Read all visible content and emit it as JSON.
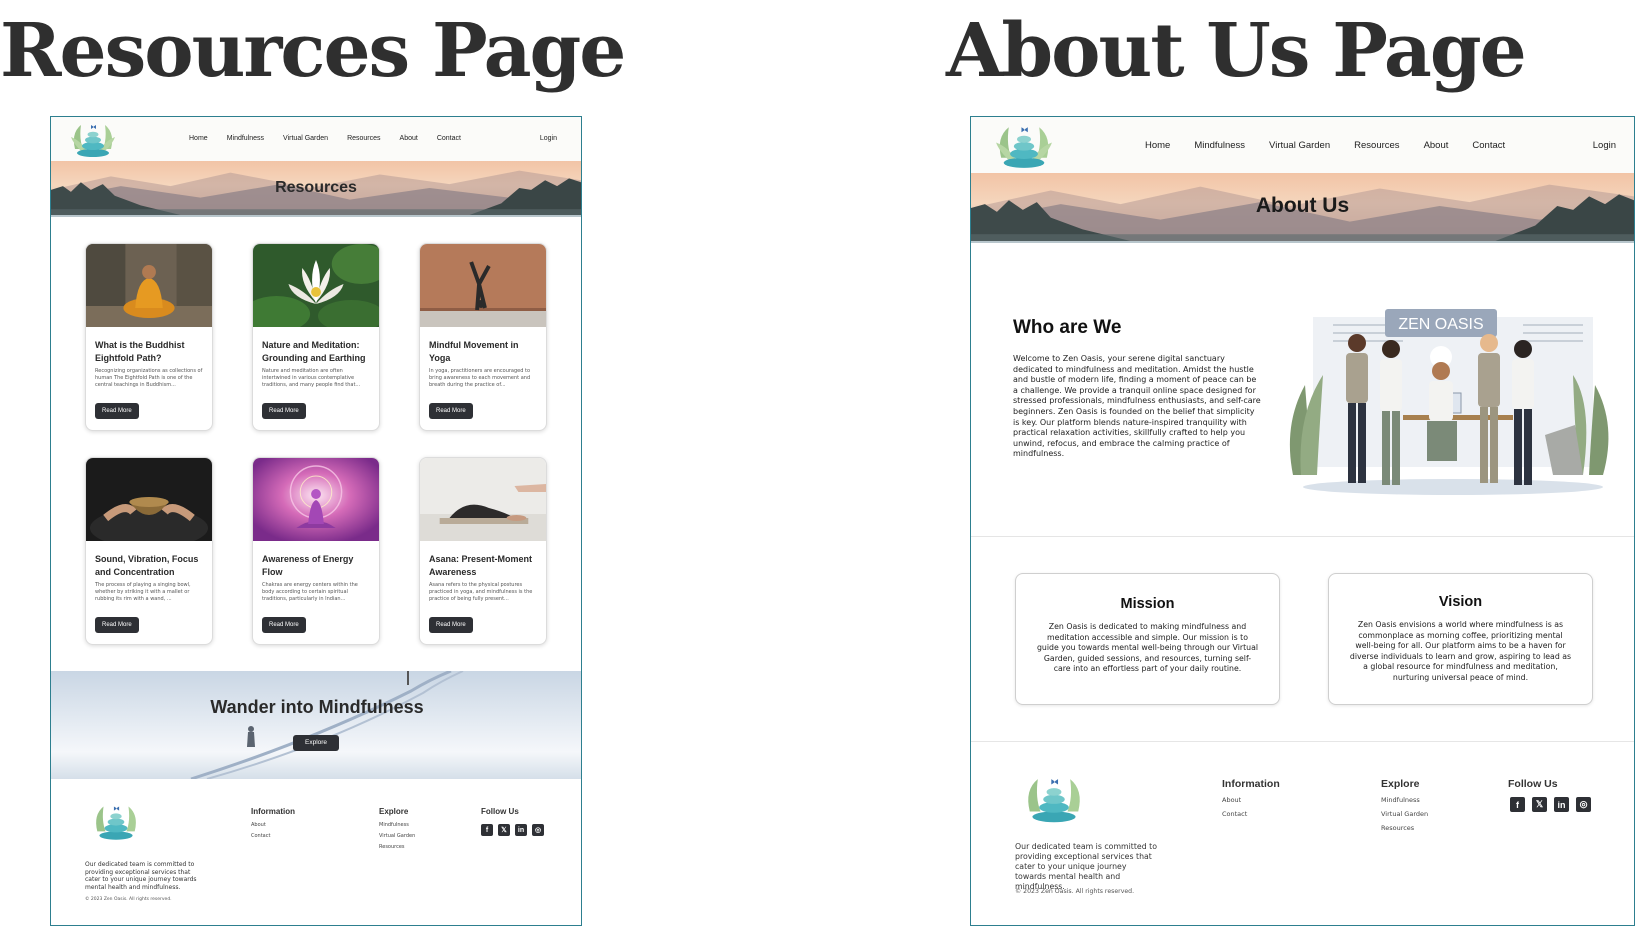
{
  "titles": {
    "left": "Resources Page",
    "right": "About Us Page"
  },
  "nav": {
    "items": [
      "Home",
      "Mindfulness",
      "Virtual Garden",
      "Resources",
      "About",
      "Contact"
    ],
    "login": "Login"
  },
  "resources_page": {
    "hero_title": "Resources",
    "read_more": "Read More",
    "cards": [
      {
        "title": "What is the Buddhist Eightfold Path?",
        "desc": "Recognizing organizations as collections of human The Eightfold Path is one of the central teachings in Buddhism...",
        "image": "monk-meditating-photo"
      },
      {
        "title": "Nature and Meditation: Grounding and Earthing",
        "desc": "Nature and meditation are often intertwined in various contemplative traditions, and many people find that...",
        "image": "lotus-flower-photo"
      },
      {
        "title": "Mindful Movement in Yoga",
        "desc": " In yoga, practitioners are encouraged to bring awareness to each movement and breath during the practice of...",
        "image": "yoga-headstand-photo"
      },
      {
        "title": "Sound, Vibration, Focus and Concentration",
        "desc": "The process of playing a singing bowl, whether by striking it with a mallet or rubbing its rim with a wand, ...",
        "image": "singing-bowl-photo"
      },
      {
        "title": "Awareness of Energy Flow",
        "desc": "Chakras are energy centers within the body according to certain spiritual traditions, particularly in Indian...",
        "image": "chakra-meditation-art"
      },
      {
        "title": "Asana: Present-Moment Awareness",
        "desc": "Asana refers to the physical postures practiced in yoga, and mindfulness is the practice of being fully present...",
        "image": "child-pose-photo"
      }
    ],
    "wander": {
      "title": "Wander into Mindfulness",
      "button": "Explore"
    }
  },
  "about_page": {
    "hero_title": "About Us",
    "who_title": "Who are We",
    "who_text": "Welcome to Zen Oasis, your serene digital sanctuary dedicated to mindfulness and meditation. Amidst the hustle and bustle of modern life, finding a moment of peace can be a challenge. We provide a tranquil online space designed for stressed professionals, mindfulness enthusiasts, and self-care beginners. Zen Oasis is founded on the belief that simplicity is key. Our platform blends nature-inspired tranquility with practical relaxation activities, skillfully crafted to help you unwind, refocus, and embrace the calming practice of mindfulness.",
    "illustration_sign": "ZEN OASIS",
    "mission": {
      "title": "Mission",
      "text": "Zen Oasis is dedicated to making mindfulness and meditation accessible and simple. Our mission is to guide you towards mental well-being through our Virtual Garden, guided sessions, and resources, turning self-care into an effortless part of your daily routine."
    },
    "vision": {
      "title": "Vision",
      "text": "Zen Oasis envisions a world where mindfulness is as commonplace as morning coffee, prioritizing mental well-being for all. Our platform aims to be a haven for diverse individuals to learn and grow, aspiring to lead as a global resource for mindfulness and meditation, nurturing universal peace of mind."
    }
  },
  "footer": {
    "description": "Our dedicated team is committed to providing exceptional services that cater to your unique journey towards mental health and mindfulness.",
    "copyright": "© 2023 Zen Oasis. All rights reserved.",
    "information": {
      "heading": "Information",
      "links": [
        "About",
        "Contact"
      ]
    },
    "explore": {
      "heading": "Explore",
      "links": [
        "Mindfulness",
        "Virtual Garden",
        "Resources"
      ]
    },
    "follow": {
      "heading": "Follow Us",
      "icons": [
        "facebook-icon",
        "x-icon",
        "linkedin-icon",
        "instagram-icon"
      ]
    }
  },
  "colors": {
    "frame_border": "#2d7f8f",
    "button_dark": "#2e3035",
    "hero_sky": "#f2c4a6"
  }
}
